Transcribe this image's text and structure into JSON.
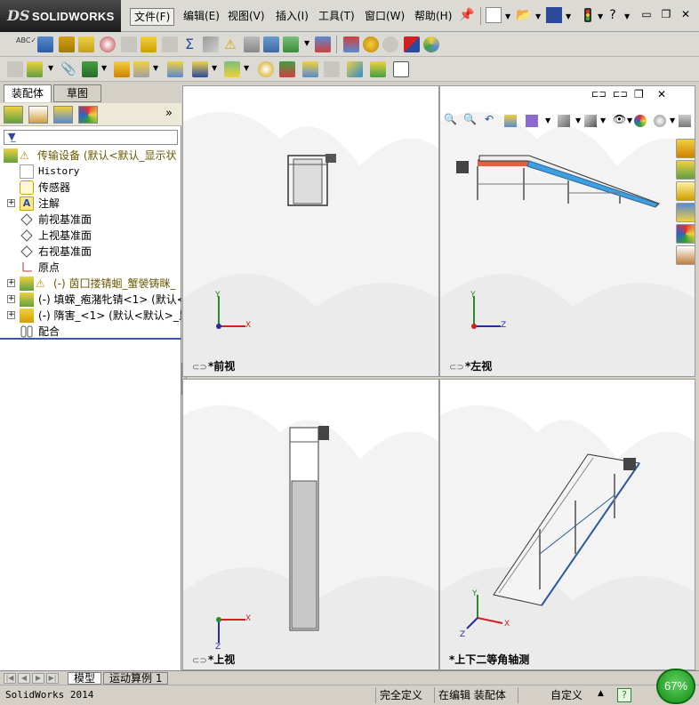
{
  "app": {
    "logo_text": "SOLIDWORKS",
    "logo_mark": "DS"
  },
  "menu": {
    "items": [
      {
        "label": "文件(F)",
        "active": true
      },
      {
        "label": "编辑(E)"
      },
      {
        "label": "视图(V)"
      },
      {
        "label": "插入(I)"
      },
      {
        "label": "工具(T)"
      },
      {
        "label": "窗口(W)"
      },
      {
        "label": "帮助(H)"
      }
    ]
  },
  "window_controls": {
    "minimize": "▭",
    "restore": "❐",
    "close": "✕"
  },
  "panel": {
    "tabs": [
      {
        "label": "装配体",
        "selected": true
      },
      {
        "label": "草图"
      }
    ],
    "expand_arrow": "»",
    "filter_icon": "funnel-icon"
  },
  "tree": {
    "items": [
      {
        "label": "传输设备  (默认<默认_显示状",
        "icon": "assembly-warning-icon",
        "root": true
      },
      {
        "label": "History",
        "icon": "history-icon"
      },
      {
        "label": "传感器",
        "icon": "sensor-icon"
      },
      {
        "label": "注解",
        "icon": "annotation-icon",
        "expandable": true
      },
      {
        "label": "前视基准面",
        "icon": "plane-icon"
      },
      {
        "label": "上视基准面",
        "icon": "plane-icon"
      },
      {
        "label": "右视基准面",
        "icon": "plane-icon"
      },
      {
        "label": "原点",
        "icon": "origin-icon"
      },
      {
        "label": "(-) 茵囗搂锖蛔_蟹褮铸眯_",
        "icon": "subassembly-warning-icon",
        "expandable": true
      },
      {
        "label": "(-) 填蝾_疱潴牝锖<1> (默认<",
        "icon": "subassembly-icon",
        "expandable": true
      },
      {
        "label": "(-) 隋害_<1> (默认<默认>_显",
        "icon": "part-icon",
        "expandable": true
      },
      {
        "label": "配合",
        "icon": "mates-icon"
      }
    ]
  },
  "viewports": {
    "front": {
      "label": "*前视",
      "axis_h": "X",
      "axis_v": "Y"
    },
    "left": {
      "label": "*左视",
      "axis_h": "Z",
      "axis_v": "Y"
    },
    "top": {
      "label": "*上视",
      "axis_h": "X",
      "axis_v": "Z"
    },
    "iso": {
      "label": "*上下二等角轴测",
      "axis_h": "X",
      "axis_v": "Y",
      "axis_d": "Z"
    }
  },
  "bottom_tabs": [
    {
      "label": "模型",
      "selected": true
    },
    {
      "label": "运动算例 1"
    }
  ],
  "status": {
    "app_version": "SolidWorks 2014",
    "definition": "完全定义",
    "mode": "在编辑 装配体",
    "units": "自定义",
    "help_icon": "?",
    "zoom": "67%"
  },
  "colors": {
    "accent_blue": "#3a5aa8",
    "conveyor_belt": "#3fa0e0",
    "motor_orange": "#e06040",
    "frame_gray": "#7a7a7a",
    "zoom_green": "#1ea21e"
  }
}
